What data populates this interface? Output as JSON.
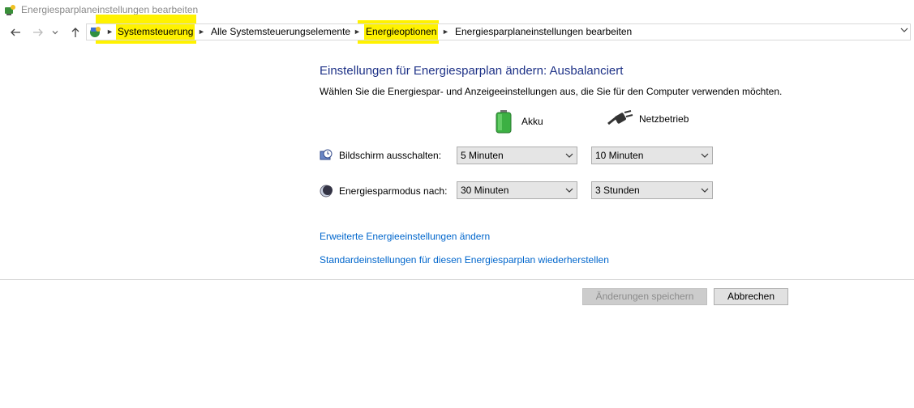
{
  "window": {
    "title": "Energiesparplaneinstellungen bearbeiten"
  },
  "navigation": {
    "back_icon": "back-arrow-icon",
    "forward_icon": "forward-arrow-icon",
    "recent_icon": "chevron-down-icon",
    "up_icon": "up-arrow-icon",
    "breadcrumbs": [
      {
        "label": "Systemsteuerung",
        "highlighted": true
      },
      {
        "label": "Alle Systemsteuerungselemente",
        "highlighted": false
      },
      {
        "label": "Energieoptionen",
        "highlighted": true
      },
      {
        "label": "Energiesparplaneinstellungen bearbeiten",
        "highlighted": false
      }
    ],
    "highlight_color": "#fff200"
  },
  "main": {
    "heading": "Einstellungen für Energiesparplan ändern: Ausbalanciert",
    "subtext": "Wählen Sie die Energiespar- und Anzeigeeinstellungen aus, die Sie für den Computer verwenden möchten.",
    "columns": {
      "battery": "Akku",
      "plugged_in": "Netzbetrieb"
    },
    "rows": [
      {
        "label": "Bildschirm ausschalten:",
        "battery_value": "5 Minuten",
        "plugged_value": "10 Minuten"
      },
      {
        "label": "Energiesparmodus nach:",
        "battery_value": "30 Minuten",
        "plugged_value": "3 Stunden"
      }
    ],
    "links": {
      "advanced": "Erweiterte Energieeinstellungen ändern",
      "restore": "Standardeinstellungen für diesen Energiesparplan wiederherstellen"
    },
    "buttons": {
      "save": "Änderungen speichern",
      "cancel": "Abbrechen"
    }
  }
}
